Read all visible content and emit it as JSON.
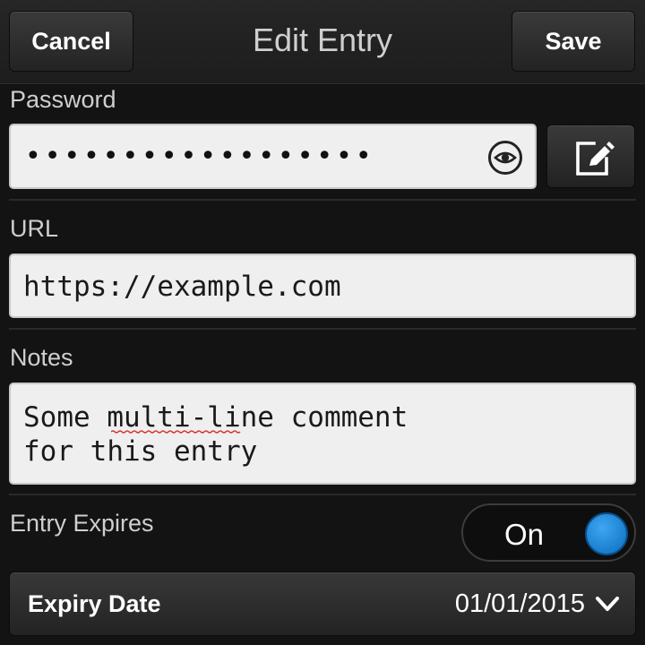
{
  "header": {
    "cancel_label": "Cancel",
    "title": "Edit Entry",
    "save_label": "Save"
  },
  "password": {
    "label": "Password",
    "masked_value": "••••••••••••••••••",
    "reveal_icon": "eye-icon",
    "edit_icon": "edit-icon"
  },
  "url": {
    "label": "URL",
    "value": "https://example.com"
  },
  "notes": {
    "label": "Notes",
    "value": "Some multi-line comment\nfor this entry"
  },
  "expires": {
    "label": "Entry Expires",
    "toggle_label": "On",
    "toggle_state": true
  },
  "expiry_date": {
    "label": "Expiry Date",
    "value": "01/01/2015",
    "icon": "chevron-down-icon"
  },
  "colors": {
    "background": "#131313",
    "accent": "#1a8ae0",
    "field_bg": "#efefef"
  }
}
